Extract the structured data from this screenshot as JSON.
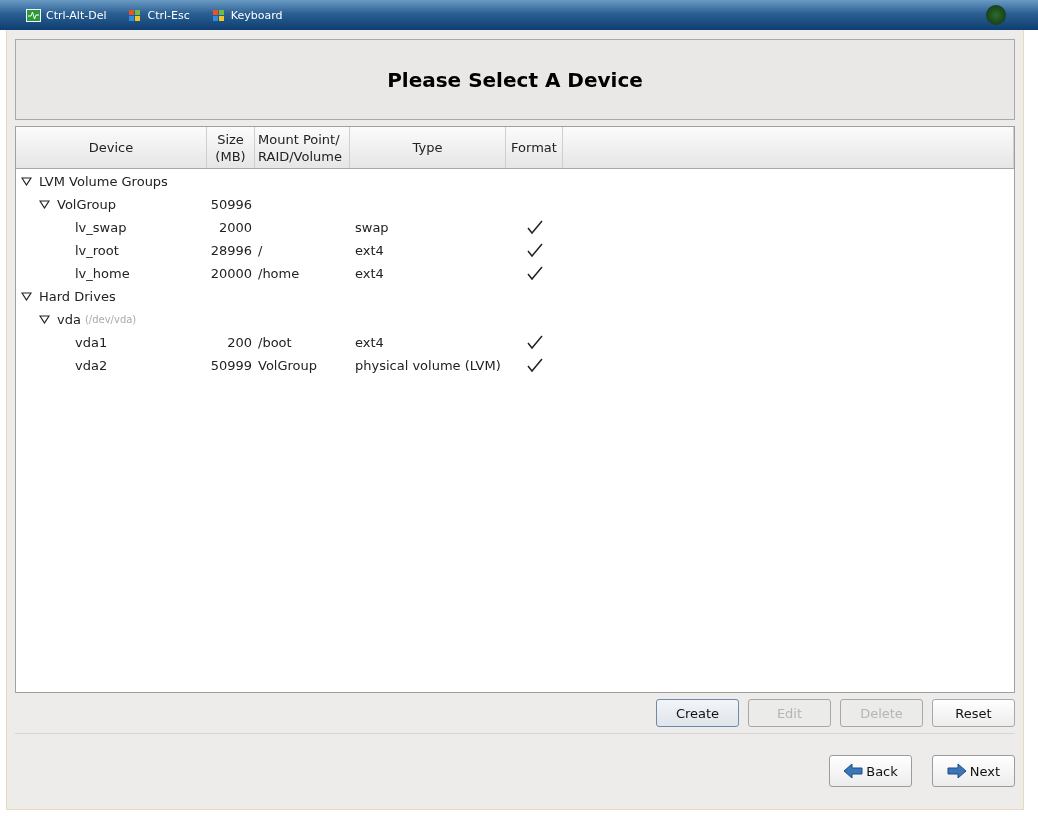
{
  "taskbar": {
    "items": [
      {
        "label": "Ctrl-Alt-Del",
        "kind": "monitor"
      },
      {
        "label": "Ctrl-Esc",
        "kind": "flag"
      },
      {
        "label": "Keyboard",
        "kind": "flag"
      }
    ]
  },
  "title": "Please Select A Device",
  "table": {
    "columns": [
      "Device",
      "Size\n(MB)",
      "Mount Point/\nRAID/Volume",
      "Type",
      "Format"
    ],
    "rows": [
      {
        "device": "LVM Volume Groups",
        "expanded": true,
        "children": [
          {
            "device": "VolGroup",
            "size": "50996",
            "expanded": true,
            "children": [
              {
                "device": "lv_swap",
                "size": "2000",
                "type": "swap",
                "format": true
              },
              {
                "device": "lv_root",
                "size": "28996",
                "mount": "/",
                "type": "ext4",
                "format": true
              },
              {
                "device": "lv_home",
                "size": "20000",
                "mount": "/home",
                "type": "ext4",
                "format": true
              }
            ]
          }
        ]
      },
      {
        "device": "Hard Drives",
        "expanded": true,
        "children": [
          {
            "device": "vda",
            "note": "(/dev/vda)",
            "expanded": true,
            "children": [
              {
                "device": "vda1",
                "size": "200",
                "mount": "/boot",
                "type": "ext4",
                "format": true
              },
              {
                "device": "vda2",
                "size": "50999",
                "mount": "VolGroup",
                "type": "physical volume (LVM)",
                "format": true
              }
            ]
          }
        ]
      }
    ]
  },
  "actions": [
    {
      "label": "Create",
      "disabled": false,
      "focused": true
    },
    {
      "label": "Edit",
      "disabled": true,
      "focused": false
    },
    {
      "label": "Delete",
      "disabled": true,
      "focused": false
    },
    {
      "label": "Reset",
      "disabled": false,
      "focused": false
    }
  ],
  "navigation": [
    {
      "label": "Back",
      "kind": "back"
    },
    {
      "label": "Next",
      "kind": "next"
    }
  ]
}
